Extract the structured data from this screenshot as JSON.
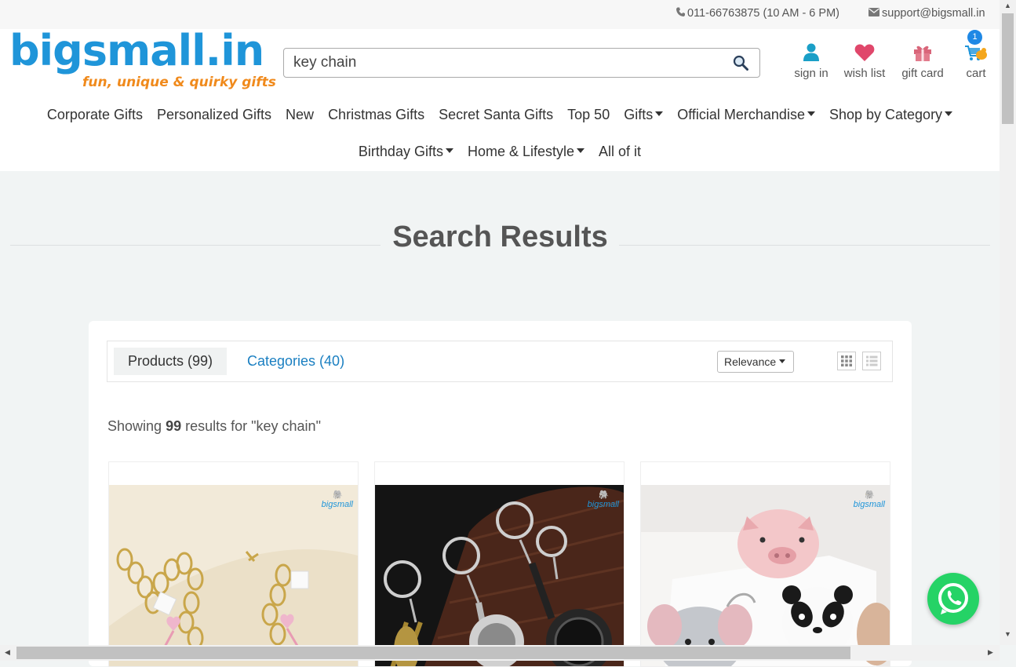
{
  "topbar": {
    "phone": "011-66763875 (10 AM - 6 PM)",
    "email": "support@bigsmall.in"
  },
  "logo": {
    "name": "bigsmall.in",
    "tagline": "fun, unique & quirky gifts"
  },
  "search": {
    "value": "key chain"
  },
  "header_icons": {
    "sign_in": "sign in",
    "wish_list": "wish list",
    "gift_card": "gift card",
    "cart": "cart",
    "cart_count": "1"
  },
  "nav": {
    "row1": [
      "Corporate Gifts",
      "Personalized Gifts",
      "New",
      "Christmas Gifts",
      "Secret Santa Gifts",
      "Top 50",
      "Gifts",
      "Official Merchandise",
      "Shop by Category"
    ],
    "row2": [
      "Birthday Gifts",
      "Home & Lifestyle",
      "All of it"
    ]
  },
  "page_title": "Search Results",
  "tabs": {
    "products": "Products (99)",
    "categories": "Categories (40)"
  },
  "sort": {
    "selected": "Relevance"
  },
  "results": {
    "prefix": "Showing",
    "count": "99",
    "suffix": "results for \"key chain\""
  },
  "products": [
    {
      "brand": "bigsmall",
      "image": "heart charm bracelet keychain"
    },
    {
      "brand": "bigsmall",
      "image": "frying pan bottle opener keychains"
    },
    {
      "brand": "bigsmall",
      "image": "plush animal keychains"
    }
  ],
  "colors": {
    "accent_blue": "#1f95d9",
    "accent_orange": "#f08a1c",
    "link_blue": "#1a7fc1",
    "whatsapp_green": "#25d366",
    "heart_pink": "#e0476b",
    "icon_teal": "#1a9fc7"
  }
}
